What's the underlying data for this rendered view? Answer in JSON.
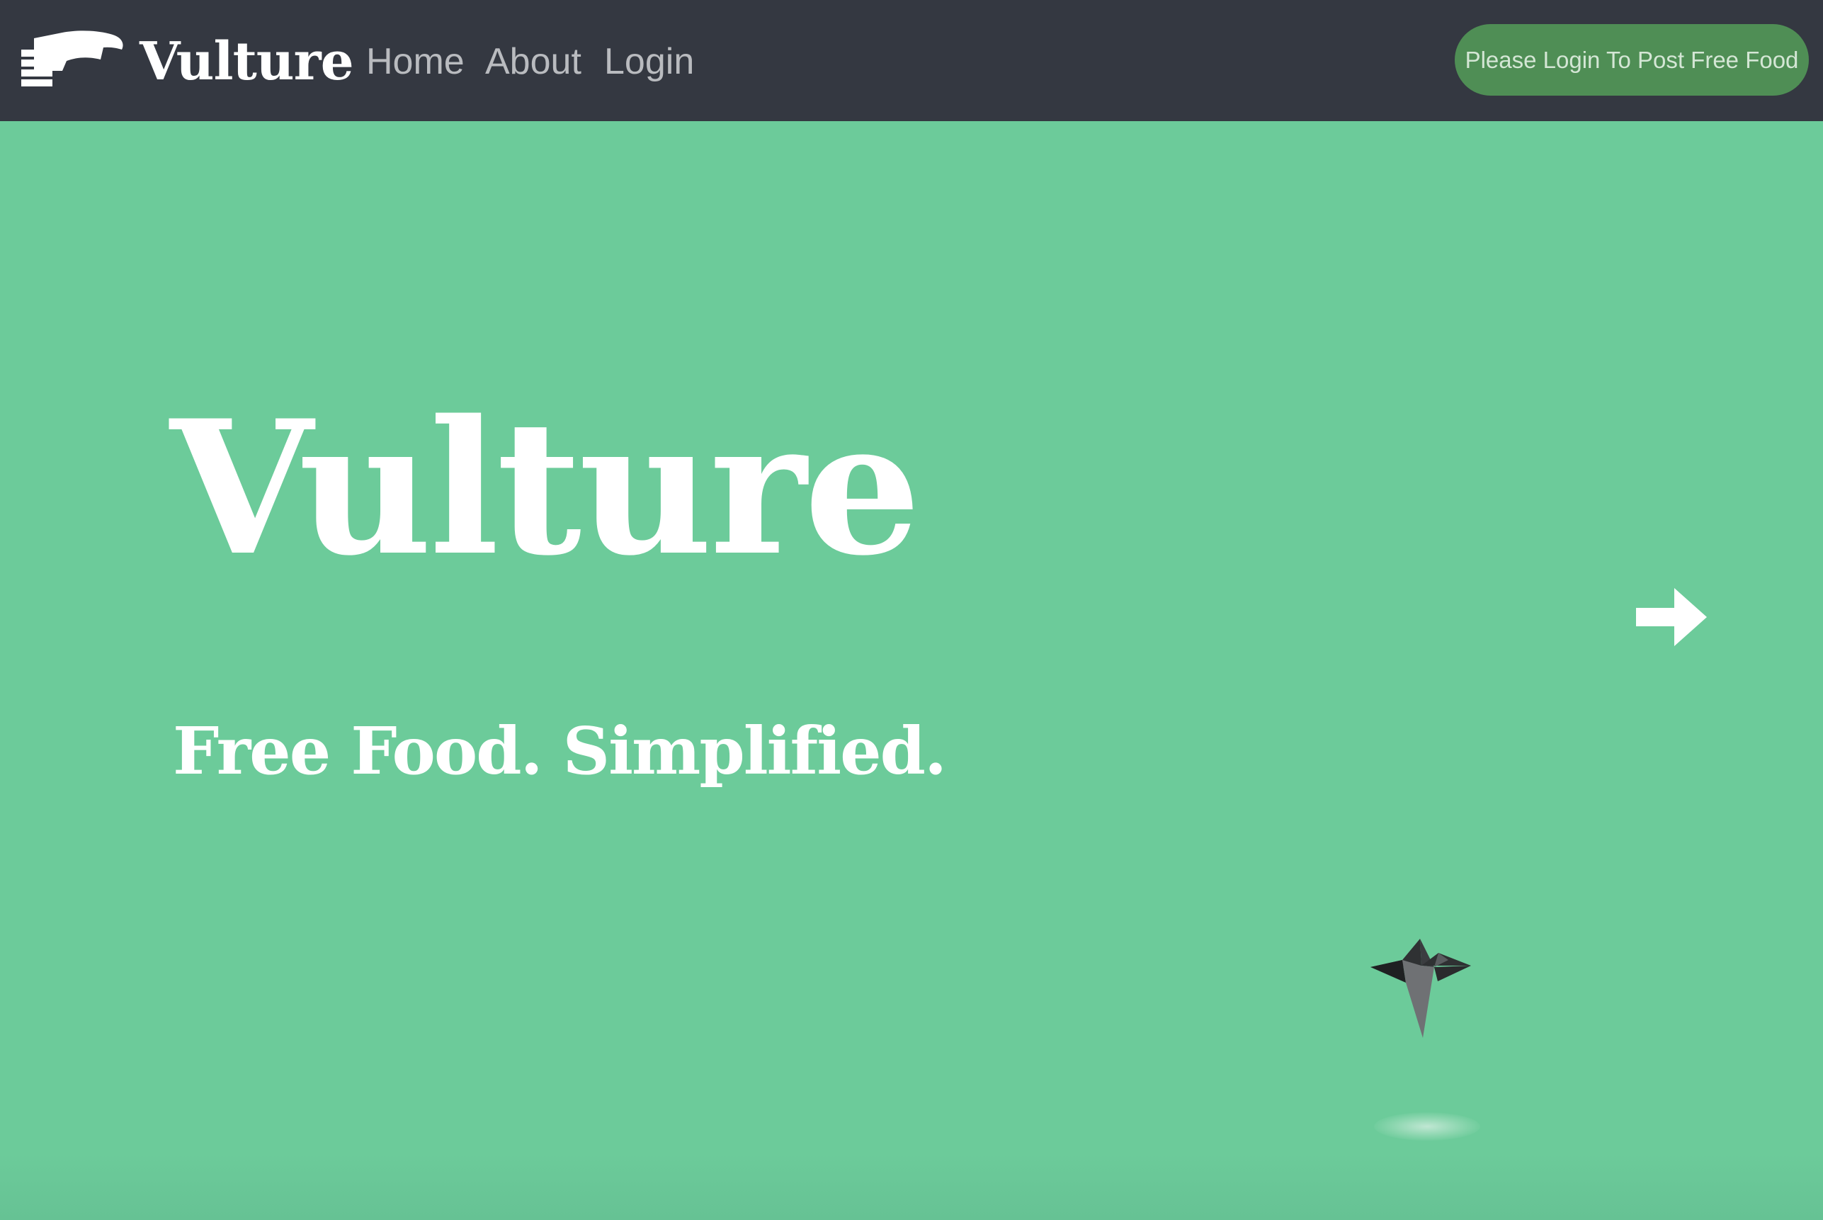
{
  "navbar": {
    "brand": "Vulture",
    "logo_icon": "vulture-logo-icon",
    "links": [
      {
        "label": "Home"
      },
      {
        "label": "About"
      },
      {
        "label": "Login"
      }
    ],
    "post_button_label": "Please Login To Post Free Food"
  },
  "hero": {
    "title": "Vulture",
    "subtitle": "Free Food. Simplified.",
    "next_icon": "right-arrow-icon",
    "bird_icon": "origami-bird-icon"
  },
  "colors": {
    "navbar_bg": "#343841",
    "hero_bg": "#6ccb9a",
    "button_bg": "#4f8e55",
    "text_white": "#ffffff",
    "nav_link": "#b9bbbf"
  }
}
